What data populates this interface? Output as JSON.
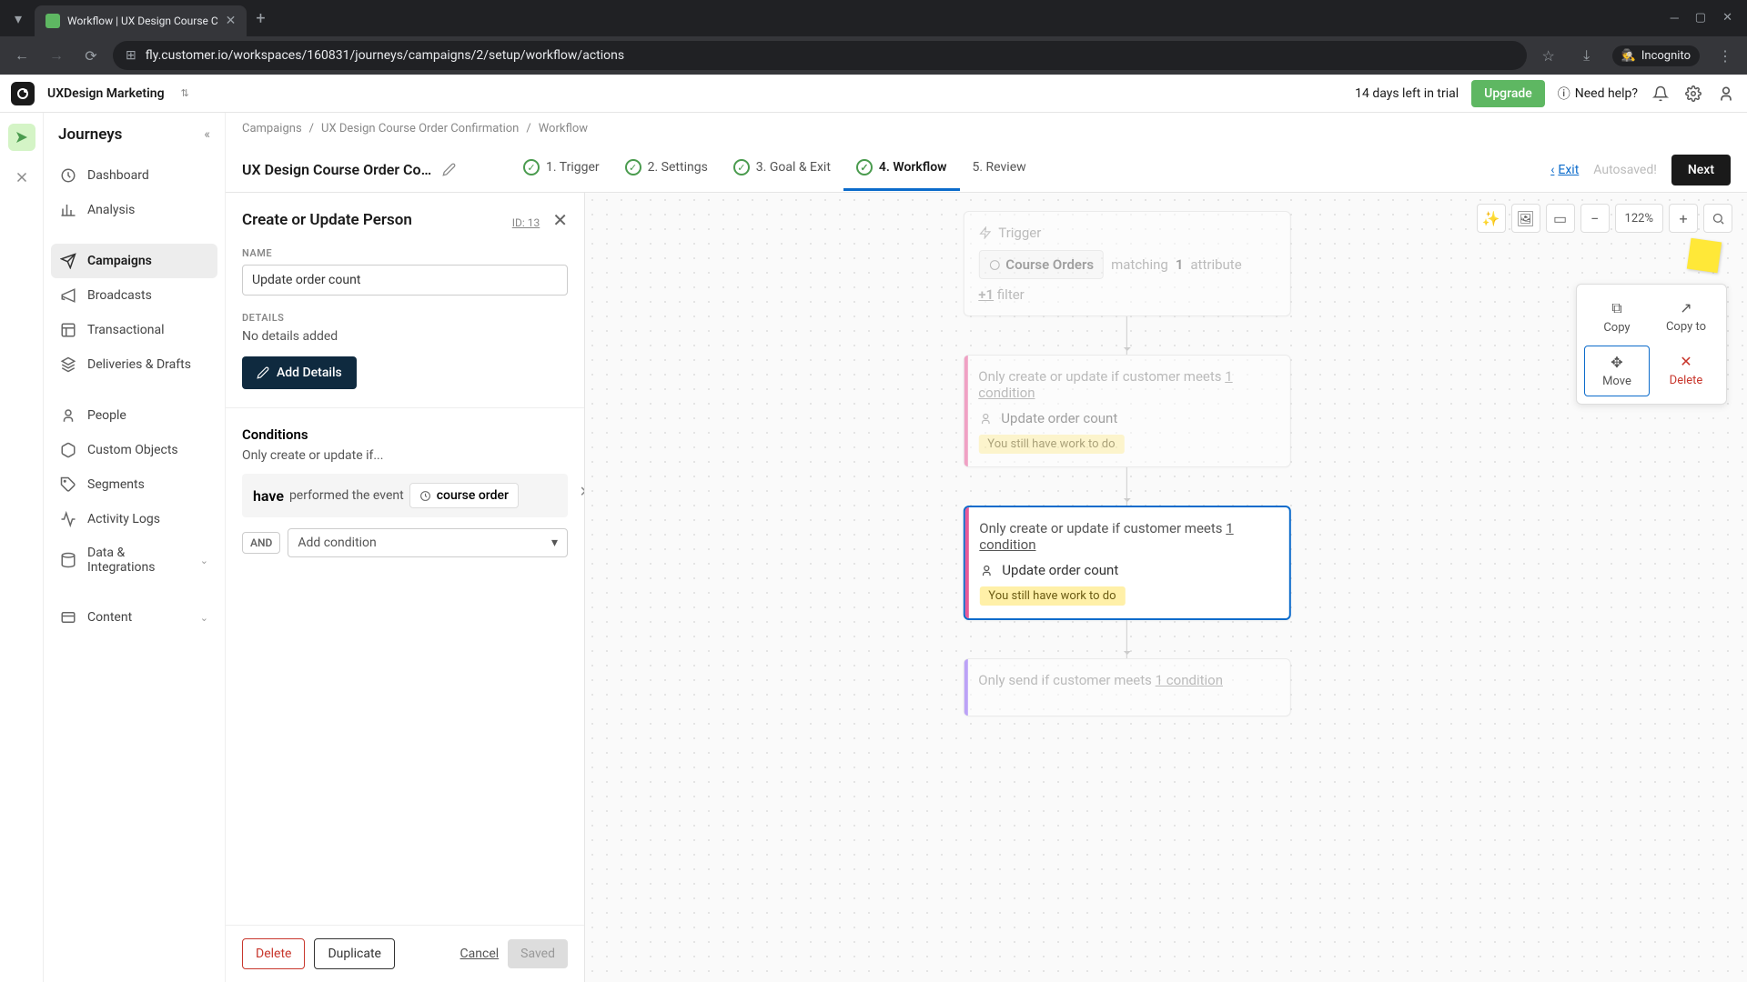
{
  "browser": {
    "tab_title": "Workflow | UX Design Course C",
    "url_display": "fly.customer.io/workspaces/160831/journeys/campaigns/2/setup/workflow/actions",
    "incognito_label": "Incognito"
  },
  "topbar": {
    "workspace": "UXDesign Marketing",
    "trial": "14 days left in trial",
    "upgrade": "Upgrade",
    "help": "Need help?"
  },
  "sidebar": {
    "title": "Journeys",
    "items": [
      {
        "label": "Dashboard",
        "icon": "home"
      },
      {
        "label": "Analysis",
        "icon": "chart"
      },
      {
        "label": "Campaigns",
        "icon": "send",
        "active": true
      },
      {
        "label": "Broadcasts",
        "icon": "megaphone"
      },
      {
        "label": "Transactional",
        "icon": "layout"
      },
      {
        "label": "Deliveries & Drafts",
        "icon": "layers"
      },
      {
        "label": "People",
        "icon": "user"
      },
      {
        "label": "Custom Objects",
        "icon": "box"
      },
      {
        "label": "Segments",
        "icon": "tag"
      },
      {
        "label": "Activity Logs",
        "icon": "activity"
      },
      {
        "label": "Data & Integrations",
        "icon": "database",
        "chevron": true
      },
      {
        "label": "Content",
        "icon": "folder",
        "chevron": true
      }
    ]
  },
  "breadcrumb": [
    "Campaigns",
    "UX Design Course Order Confirmation",
    "Workflow"
  ],
  "header": {
    "title": "UX Design Course Order Confir…",
    "steps": [
      "1. Trigger",
      "2. Settings",
      "3. Goal & Exit",
      "4. Workflow",
      "5. Review"
    ],
    "active_step": 3,
    "exit": "Exit",
    "autosaved": "Autosaved!",
    "next": "Next"
  },
  "panel": {
    "title": "Create or Update Person",
    "id": "ID: 13",
    "name_label": "NAME",
    "name_value": "Update order count",
    "details_label": "DETAILS",
    "details_empty": "No details added",
    "add_details": "Add Details",
    "conditions_title": "Conditions",
    "conditions_sub": "Only create or update if...",
    "cond_have": "have",
    "cond_text": "performed the event",
    "cond_event": "course order",
    "and_label": "AND",
    "add_condition": "Add condition",
    "footer": {
      "delete": "Delete",
      "duplicate": "Duplicate",
      "cancel": "Cancel",
      "saved": "Saved"
    }
  },
  "canvas": {
    "zoom": "122%",
    "trigger": {
      "label": "Trigger",
      "segment": "Course Orders",
      "matching": "matching",
      "count": "1",
      "attribute": "attribute",
      "filter_prefix": "+",
      "filter_count": "1",
      "filter_text": "filter"
    },
    "node1": {
      "cond_text": "Only create or update if customer meets",
      "cond_link": "1 condition",
      "action": "Update order count",
      "badge": "You still have work to do"
    },
    "node2": {
      "cond_text": "Only create or update if customer meets",
      "cond_link": "1 condition",
      "action": "Update order count",
      "badge": "You still have work to do"
    },
    "node3": {
      "cond_text": "Only send if customer meets",
      "cond_link": "1 condition"
    }
  },
  "context": {
    "copy": "Copy",
    "copy_to": "Copy to",
    "move": "Move",
    "delete": "Delete"
  }
}
